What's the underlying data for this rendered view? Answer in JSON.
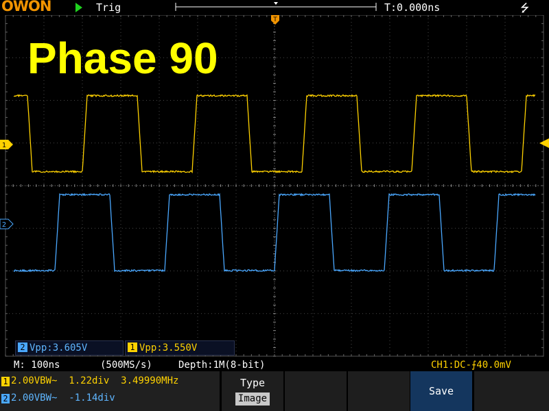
{
  "header": {
    "logo": "OWON",
    "trigger_status": "Trig",
    "time_offset": "T:0.000ns",
    "icons": {
      "run": "play-icon",
      "usb": "usb-icon"
    }
  },
  "screen": {
    "overlay_title": "Phase 90",
    "markers": {
      "trigger_marker": "T",
      "ch1_marker": "1",
      "ch2_marker": "2"
    }
  },
  "measurements": [
    {
      "channel": "2",
      "text": "Vpp:3.605V"
    },
    {
      "channel": "1",
      "text": "Vpp:3.550V"
    }
  ],
  "status": {
    "mem_time": "M: 100ns",
    "sample_rate": "(500MS/s)",
    "depth": "Depth:1M(8-bit)",
    "trigger": "CH1:DC-⨍40.0mV"
  },
  "channels": [
    {
      "num": "1",
      "text": "2.00VBW~  1.22div  3.49990MHz"
    },
    {
      "num": "2",
      "text": "2.00VBW~  -1.14div"
    }
  ],
  "menu": {
    "type_label": "Type",
    "type_value": "Image",
    "save_label": "Save"
  },
  "colors": {
    "ch1": "#ffd200",
    "ch2": "#4aa8ff",
    "logo": "#f29400",
    "run": "#1fd11f",
    "overlay": "#ffff00",
    "save_button": "#14365e"
  },
  "waveforms": {
    "period_ns": 285.7,
    "phase_deg": 90,
    "ch1_offset_div": 1.22,
    "ch2_offset_div": -1.14,
    "amplitude_div": 1.78
  }
}
